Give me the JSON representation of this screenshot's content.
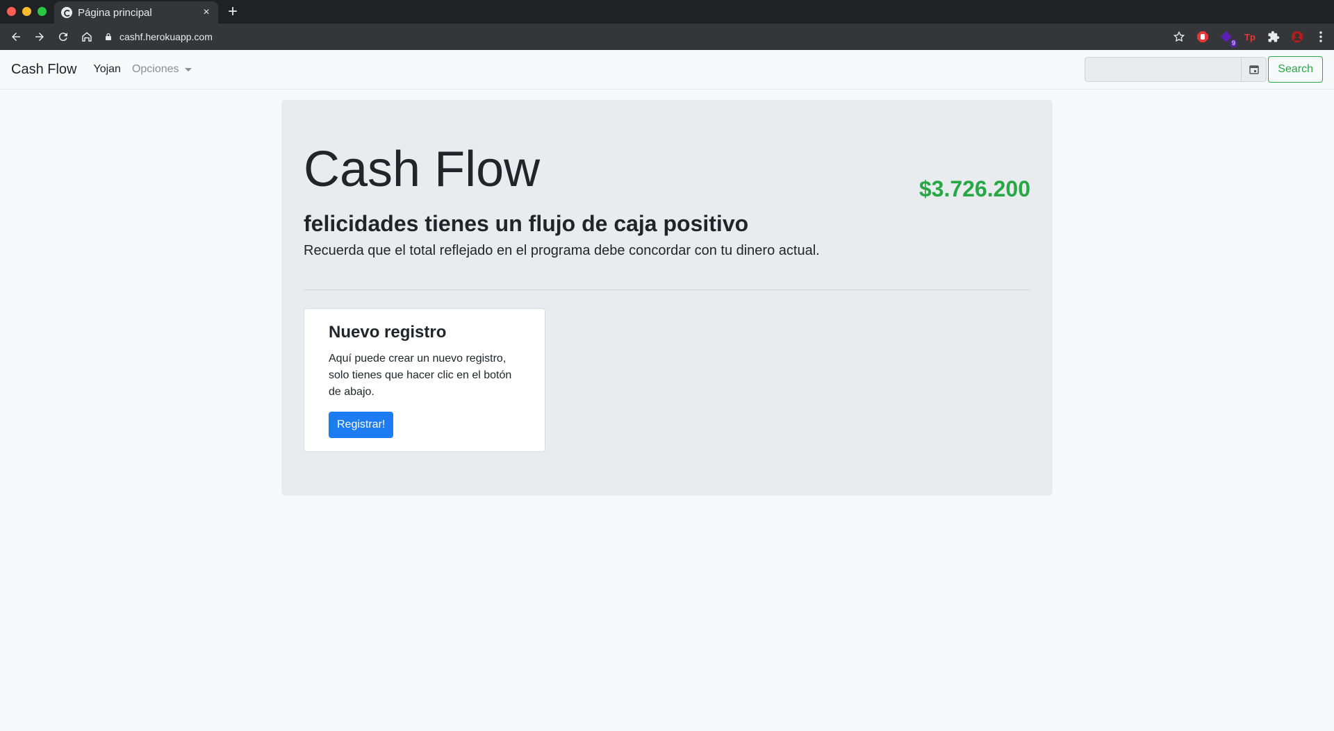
{
  "browser": {
    "tab_title": "Página principal",
    "close_symbol": "×",
    "new_tab_symbol": "+",
    "url": "cashf.herokuapp.com",
    "traffic_colors": [
      "#ff5f57",
      "#febc2e",
      "#28c840"
    ],
    "extensions": [
      {
        "icon": "stop-hand-icon",
        "color": "#e53935"
      },
      {
        "icon": "puzzle-badge-icon",
        "color": "#5b21b6",
        "badge": "9"
      },
      {
        "icon": "tp-icon",
        "color": "#e53935",
        "label": "Tp"
      },
      {
        "icon": "extensions-icon",
        "color": "#e8eaed"
      },
      {
        "icon": "avatar-icon",
        "color": "#b71c1c"
      },
      {
        "icon": "menu-icon",
        "color": "#e8eaed"
      }
    ]
  },
  "navbar": {
    "brand": "Cash Flow",
    "user": "Yojan",
    "options_label": "Opciones",
    "search_label": "Search"
  },
  "jumbotron": {
    "title": "Cash Flow",
    "balance": "$3.726.200",
    "subtitle": "felicidades tienes un flujo de caja positivo",
    "lead": "Recuerda que el total reflejado en el programa debe concordar con tu dinero actual."
  },
  "card": {
    "title": "Nuevo registro",
    "text": "Aquí puede crear un nuevo registro, solo tienes que hacer clic en el botón de abajo.",
    "button_label": "Registrar!"
  },
  "colors": {
    "accent_green": "#28a745",
    "primary_blue": "#1e7cf2",
    "jumbotron_bg": "#e9ecef"
  }
}
